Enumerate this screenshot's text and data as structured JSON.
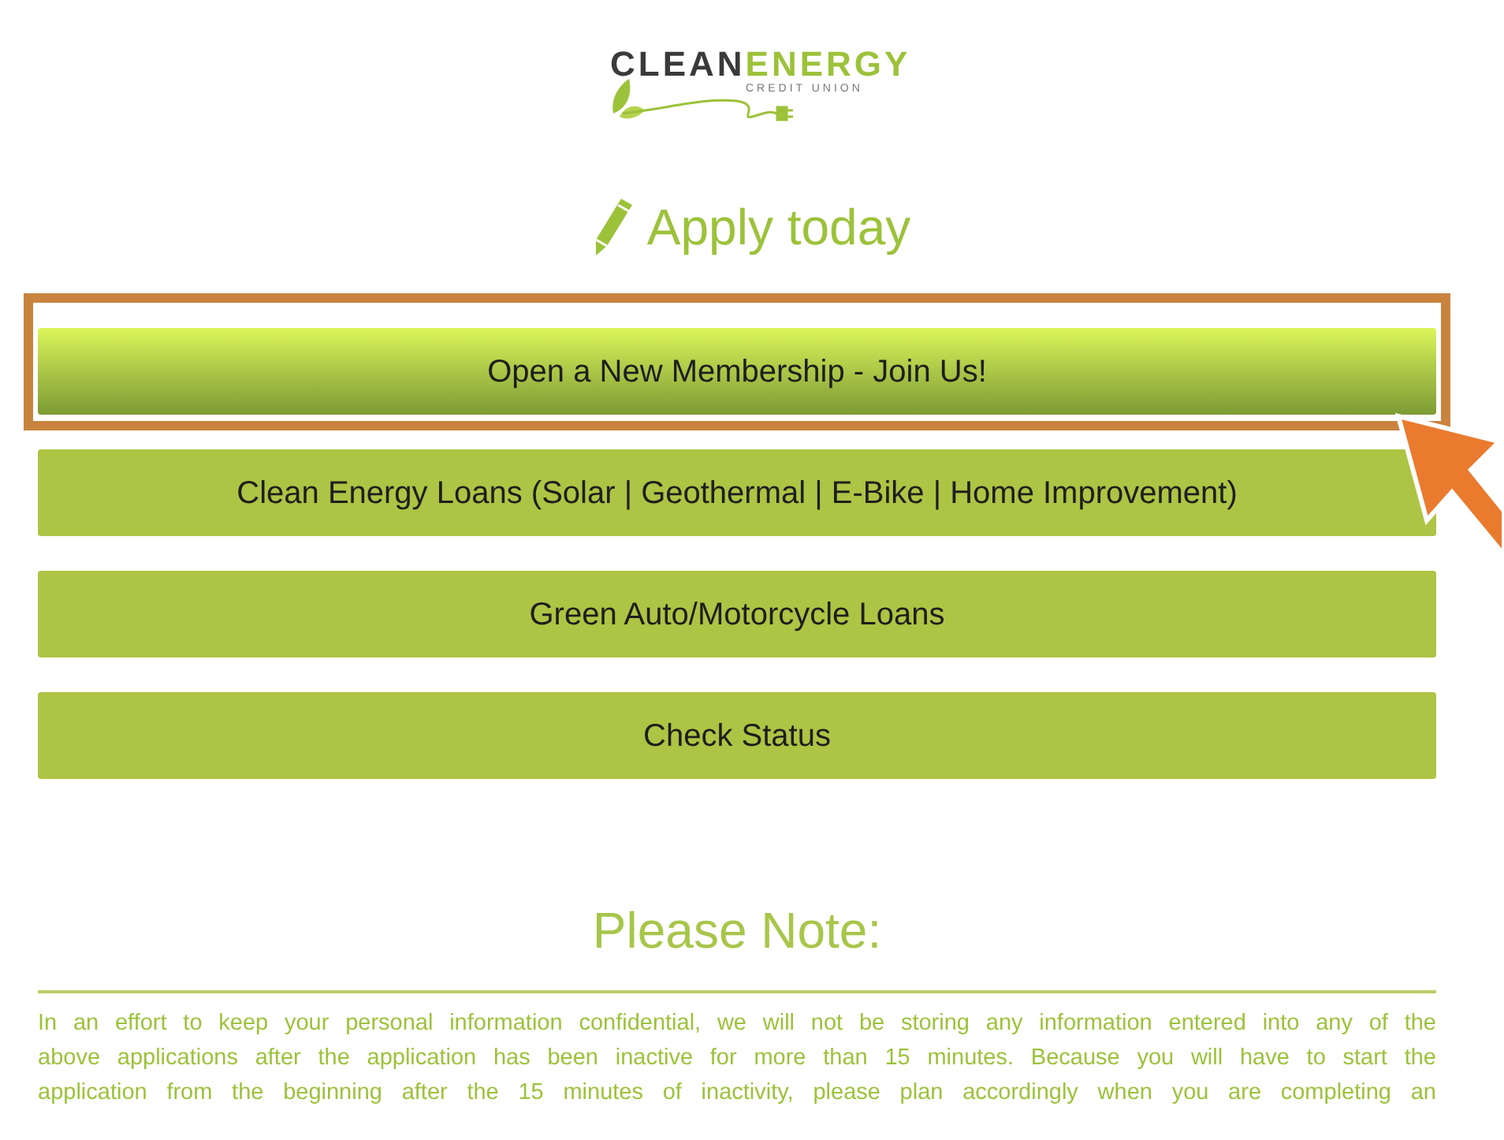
{
  "logo": {
    "name_first": "CLEAN",
    "name_second": "ENERGY",
    "tagline": "CREDIT UNION"
  },
  "heading": "Apply today",
  "buttons": [
    {
      "label": "Open a New Membership - Join Us!",
      "highlighted": true
    },
    {
      "label": "Clean Energy Loans (Solar | Geothermal | E-Bike | Home Improvement)",
      "highlighted": false
    },
    {
      "label": "Green Auto/Motorcycle Loans",
      "highlighted": false
    },
    {
      "label": "Check Status",
      "highlighted": false
    }
  ],
  "note": {
    "title": "Please Note:",
    "lines": [
      "In an effort to keep your personal information confidential, we will not be storing any information entered into any of the",
      "above applications after the application has been inactive for more than 15 minutes. Because you will have to start the",
      "application from the beginning after the 15 minutes of inactivity, please plan accordingly when you are completing an"
    ]
  }
}
